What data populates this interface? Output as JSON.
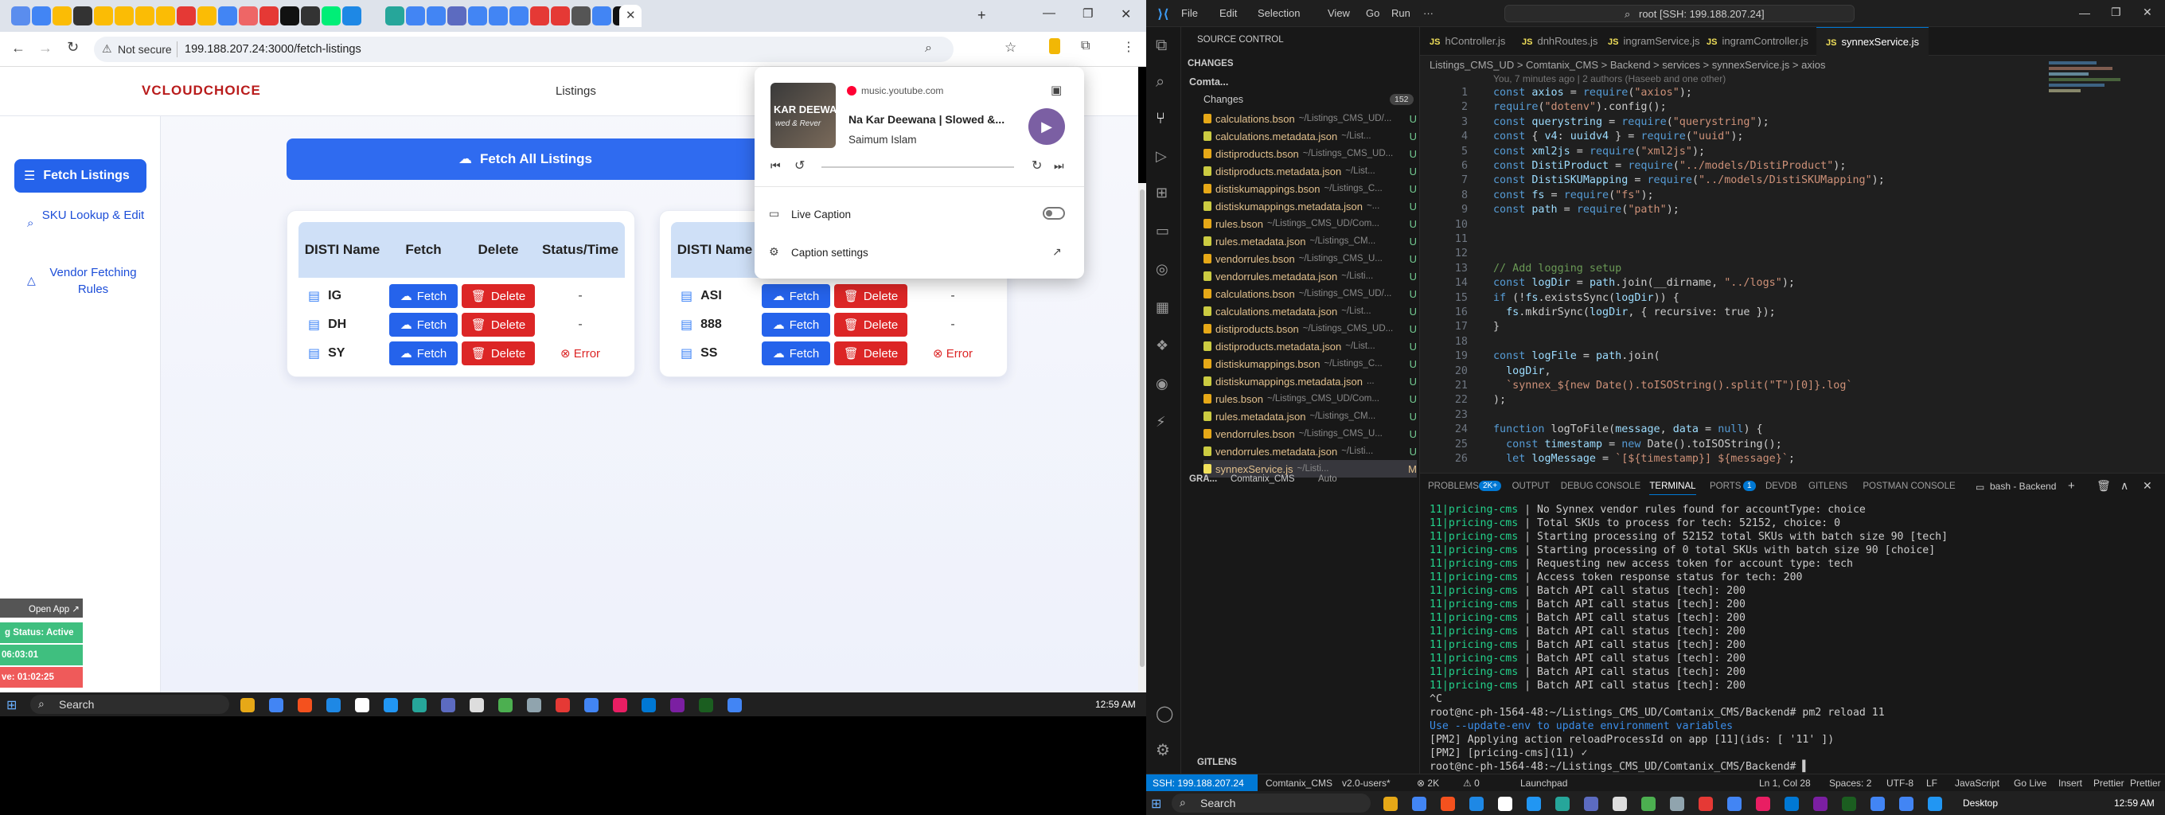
{
  "browser": {
    "url": "199.188.207.24:3000/fetch-listings",
    "not_secure": "Not secure",
    "tab_colors": [
      "#5a8dee",
      "#4285f4",
      "#fbbc05",
      "#333333",
      "#fbbc05",
      "#fbbc05",
      "#fbbc05",
      "#fbbc05",
      "#e53935",
      "#fbbc05",
      "#4285f4",
      "#e66",
      "#e53935",
      "#111111",
      "#333333",
      "#0e7",
      "#1e88e5",
      "#26a69a",
      "#4285f4",
      "#4285f4",
      "#5c6bc0",
      "#4285f4",
      "#4285f4",
      "#4285f4",
      "#e53935",
      "#e53935",
      "#555555",
      "#4285f4",
      "#111111"
    ]
  },
  "app": {
    "logo": "VCLOUDCHOICE",
    "nav_title": "Listings",
    "sidebar": {
      "active": "Fetch Listings",
      "items": [
        "SKU Lookup & Edit",
        "Vendor Fetching Rules"
      ]
    },
    "fetch_all": "Fetch All Listings",
    "headers": [
      "DISTI Name",
      "Fetch",
      "Delete",
      "Status/Time"
    ],
    "cards": [
      {
        "rows": [
          {
            "name": "IG",
            "status": "-"
          },
          {
            "name": "DH",
            "status": "-"
          },
          {
            "name": "SY",
            "status": "Error"
          }
        ]
      },
      {
        "rows": [
          {
            "name": "ASI",
            "status": "-"
          },
          {
            "name": "888",
            "status": "-"
          },
          {
            "name": "SS",
            "status": "Error"
          }
        ]
      }
    ],
    "fetch_label": "Fetch",
    "delete_label": "Delete",
    "overlay": {
      "open_app": "Open App ↗",
      "status": "g Status: Active",
      "time1": "06:03:01",
      "time2": "ve: 01:02:25"
    }
  },
  "media": {
    "source": "music.youtube.com",
    "title": "Na Kar Deewana | Slowed &...",
    "artist": "Saimum Islam",
    "art_text": "KAR DEEWA",
    "art_sub": "wed & Rever",
    "live_caption": "Live Caption",
    "caption_settings": "Caption settings"
  },
  "taskbar": {
    "search": "Search",
    "time": "12:59 AM",
    "desktop": "Desktop"
  },
  "vscode": {
    "menu": [
      "File",
      "Edit",
      "Selection",
      "View",
      "Go",
      "Run",
      "···"
    ],
    "search": "root [SSH: 199.188.207.24]",
    "scm_title": "SOURCE CONTROL",
    "changes": "CHANGES",
    "repo": "Comta...",
    "changes_sub": "Changes",
    "badge": "152",
    "files": [
      {
        "n": "calculations.bson",
        "p": "~/Listings_CMS_UD/...",
        "s": "U"
      },
      {
        "n": "calculations.metadata.json",
        "p": "~/List...",
        "s": "U"
      },
      {
        "n": "distiproducts.bson",
        "p": "~/Listings_CMS_UD...",
        "s": "U"
      },
      {
        "n": "distiproducts.metadata.json",
        "p": "~/List...",
        "s": "U"
      },
      {
        "n": "distiskumappings.bson",
        "p": "~/Listings_C...",
        "s": "U"
      },
      {
        "n": "distiskumappings.metadata.json",
        "p": "~...",
        "s": "U"
      },
      {
        "n": "rules.bson",
        "p": "~/Listings_CMS_UD/Com...",
        "s": "U"
      },
      {
        "n": "rules.metadata.json",
        "p": "~/Listings_CM...",
        "s": "U"
      },
      {
        "n": "vendorrules.bson",
        "p": "~/Listings_CMS_U...",
        "s": "U"
      },
      {
        "n": "vendorrules.metadata.json",
        "p": "~/Listi...",
        "s": "U"
      },
      {
        "n": "calculations.bson",
        "p": "~/Listings_CMS_UD/...",
        "s": "U"
      },
      {
        "n": "calculations.metadata.json",
        "p": "~/List...",
        "s": "U"
      },
      {
        "n": "distiproducts.bson",
        "p": "~/Listings_CMS_UD...",
        "s": "U"
      },
      {
        "n": "distiproducts.metadata.json",
        "p": "~/List...",
        "s": "U"
      },
      {
        "n": "distiskumappings.bson",
        "p": "~/Listings_C...",
        "s": "U"
      },
      {
        "n": "distiskumappings.metadata.json",
        "p": "...",
        "s": "U"
      },
      {
        "n": "rules.bson",
        "p": "~/Listings_CMS_UD/Com...",
        "s": "U"
      },
      {
        "n": "rules.metadata.json",
        "p": "~/Listings_CM...",
        "s": "U"
      },
      {
        "n": "vendorrules.bson",
        "p": "~/Listings_CMS_U...",
        "s": "U"
      },
      {
        "n": "vendorrules.metadata.json",
        "p": "~/Listi...",
        "s": "U"
      },
      {
        "n": "synnexService.js",
        "p": "~/Listi...",
        "s": "M"
      }
    ],
    "graph": "GRA...",
    "graph_repo": "Comtanix_CMS",
    "graph_auto": "Auto",
    "gitlens": "GITLENS",
    "tabs": [
      "hController.js",
      "dnhRoutes.js",
      "ingramService.js",
      "ingramController.js",
      "synnexService.js"
    ],
    "breadcrumb": "Listings_CMS_UD > Comtanix_CMS > Backend > services > synnexService.js > axios",
    "blame": "You, 7 minutes ago | 2 authors (Haseeb and one other)",
    "code": [
      "const axios = require(\"axios\");",
      "require(\"dotenv\").config();",
      "const querystring = require(\"querystring\");",
      "const { v4: uuidv4 } = require(\"uuid\");",
      "const xml2js = require(\"xml2js\");",
      "const DistiProduct = require(\"../models/DistiProduct\");",
      "const DistiSKUMapping = require(\"../models/DistiSKUMapping\");",
      "const fs = require(\"fs\");",
      "const path = require(\"path\");",
      "",
      "",
      "",
      "// Add logging setup",
      "const logDir = path.join(__dirname, \"../logs\");",
      "if (!fs.existsSync(logDir)) {",
      "  fs.mkdirSync(logDir, { recursive: true });",
      "}",
      "",
      "const logFile = path.join(",
      "  logDir,",
      "  `synnex_${new Date().toISOString().split(\"T\")[0]}.log`",
      ");",
      "",
      "function logToFile(message, data = null) {",
      "  const timestamp = new Date().toISOString();",
      "  let logMessage = `[${timestamp}] ${message}`;"
    ],
    "panel_tabs": [
      "PROBLEMS",
      "OUTPUT",
      "DEBUG CONSOLE",
      "TERMINAL",
      "PORTS",
      "DEVDB",
      "GITLENS",
      "POSTMAN CONSOLE"
    ],
    "problems_badge": "2K+",
    "ports_badge": "1",
    "terminal_name": "bash - Backend",
    "terminal": [
      {
        "p": "11|pricing-cms",
        "t": "| No Synnex vendor rules found for accountType: choice"
      },
      {
        "p": "11|pricing-cms",
        "t": "| Total SKUs to process for tech: 52152, choice: 0"
      },
      {
        "p": "11|pricing-cms",
        "t": "| Starting processing of 52152 total SKUs with batch size 90 [tech]"
      },
      {
        "p": "11|pricing-cms",
        "t": "| Starting processing of 0 total SKUs with batch size 90 [choice]"
      },
      {
        "p": "11|pricing-cms",
        "t": "| Requesting new access token for account type: tech"
      },
      {
        "p": "11|pricing-cms",
        "t": "| Access token response status for tech: 200"
      },
      {
        "p": "11|pricing-cms",
        "t": "| Batch API call status [tech]: 200"
      },
      {
        "p": "11|pricing-cms",
        "t": "| Batch API call status [tech]: 200"
      },
      {
        "p": "11|pricing-cms",
        "t": "| Batch API call status [tech]: 200"
      },
      {
        "p": "11|pricing-cms",
        "t": "| Batch API call status [tech]: 200"
      },
      {
        "p": "11|pricing-cms",
        "t": "| Batch API call status [tech]: 200"
      },
      {
        "p": "11|pricing-cms",
        "t": "| Batch API call status [tech]: 200"
      },
      {
        "p": "11|pricing-cms",
        "t": "| Batch API call status [tech]: 200"
      },
      {
        "p": "11|pricing-cms",
        "t": "| Batch API call status [tech]: 200"
      },
      {
        "p": "",
        "t": "^C"
      },
      {
        "p": "",
        "t": "root@nc-ph-1564-48:~/Listings_CMS_UD/Comtanix_CMS/Backend# pm2 reload 11"
      },
      {
        "p": "",
        "t": "Use --update-env to update environment variables"
      },
      {
        "p": "",
        "t": "[PM2] Applying action reloadProcessId on app [11](ids: [ '11' ])"
      },
      {
        "p": "",
        "t": "[PM2] [pricing-cms](11) ✓"
      },
      {
        "p": "",
        "t": "root@nc-ph-1564-48:~/Listings_CMS_UD/Comtanix_CMS/Backend# ▌"
      }
    ],
    "status": {
      "ssh": "SSH: 199.188.207.24",
      "branch": "Comtanix_CMS",
      "ver": "v2.0-users*",
      "errors": "⊗ 2K",
      "warn": "⚠ 0",
      "launchpad": "Launchpad",
      "pos": "Ln 1, Col 28",
      "spaces": "Spaces: 2",
      "enc": "UTF-8",
      "eol": "LF",
      "lang": "JavaScript",
      "golive": "Go Live",
      "insert": "Insert",
      "prettier": "Prettier",
      "prettier2": "Prettier"
    }
  }
}
